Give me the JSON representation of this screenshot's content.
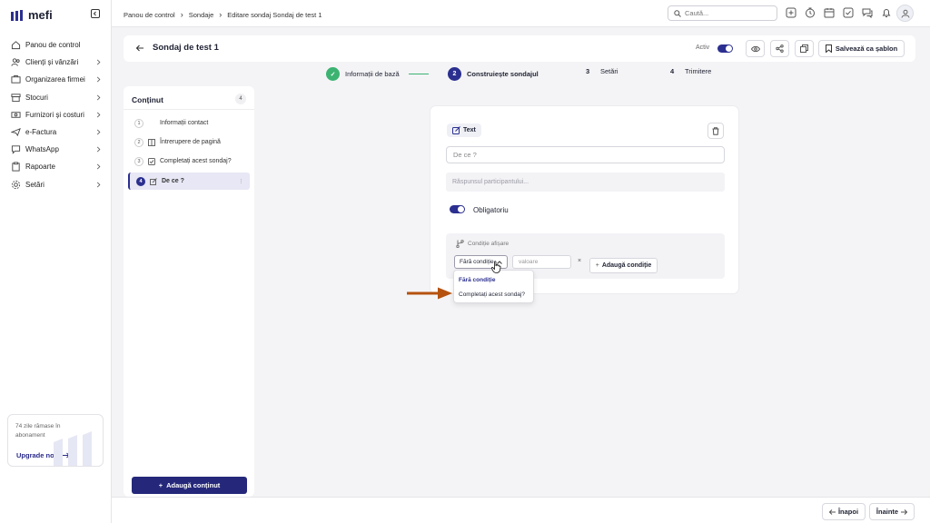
{
  "app": {
    "logo_text": "mefi"
  },
  "sidebar": {
    "items": [
      {
        "label": "Panou de control",
        "icon": "home-icon",
        "has_children": false
      },
      {
        "label": "Clienți și vânzări",
        "icon": "users-icon",
        "has_children": true
      },
      {
        "label": "Organizarea firmei",
        "icon": "org-icon",
        "has_children": true
      },
      {
        "label": "Stocuri",
        "icon": "box-icon",
        "has_children": true
      },
      {
        "label": "Furnizori și costuri",
        "icon": "money-icon",
        "has_children": true
      },
      {
        "label": "e-Factura",
        "icon": "plane-icon",
        "has_children": true
      },
      {
        "label": "WhatsApp",
        "icon": "chat-icon",
        "has_children": true
      },
      {
        "label": "Rapoarte",
        "icon": "clipboard-icon",
        "has_children": true
      },
      {
        "label": "Setări",
        "icon": "gear-icon",
        "has_children": true
      }
    ],
    "upgrade": {
      "text": "74 zile rămase în abonament",
      "link": "Upgrade now"
    }
  },
  "topbar": {
    "breadcrumb": [
      "Panou de control",
      "Sondaje",
      "Editare sondaj Sondaj de test 1"
    ],
    "search_placeholder": "Caută..."
  },
  "header": {
    "title": "Sondaj de test 1",
    "active_label": "Activ",
    "active_on": true,
    "template_button": "Salvează ca șablon"
  },
  "steps": [
    {
      "number": "✓",
      "label": "Informații de bază",
      "state": "done"
    },
    {
      "number": "2",
      "label": "Construiește sondajul",
      "state": "current"
    },
    {
      "number": "3",
      "label": "Setări",
      "state": "pending"
    },
    {
      "number": "4",
      "label": "Trimitere",
      "state": "pending"
    }
  ],
  "content_panel": {
    "title": "Conținut",
    "count": "4",
    "items": [
      {
        "number": "1",
        "label": "Informații contact",
        "icon": "",
        "active": false
      },
      {
        "number": "2",
        "label": "Întrerupere de pagină",
        "icon": "page-break-icon",
        "active": false
      },
      {
        "number": "3",
        "label": "Completați acest sondaj?",
        "icon": "checkbox-icon",
        "active": false
      },
      {
        "number": "4",
        "label": "De ce ?",
        "icon": "edit-icon",
        "active": true
      }
    ],
    "add_button": "Adaugă conținut"
  },
  "question_card": {
    "type_label": "Text",
    "question_value": "De ce ?",
    "answer_placeholder": "Răspunsul participantului...",
    "required_label": "Obligatoriu",
    "required_on": true,
    "conditions_title": "Condiție afișare",
    "condition_select": "Fără condiție",
    "value_placeholder": "valoare",
    "remove": "×",
    "add_condition": "Adaugă condiție",
    "dropdown_options": [
      "Fără condiție",
      "Completați acest sondaj?"
    ]
  },
  "footer": {
    "back": "Înapoi",
    "next": "Înainte"
  },
  "colors": {
    "accent": "#2b2f8f",
    "success": "#3cb371",
    "arrow": "#b5520f"
  }
}
